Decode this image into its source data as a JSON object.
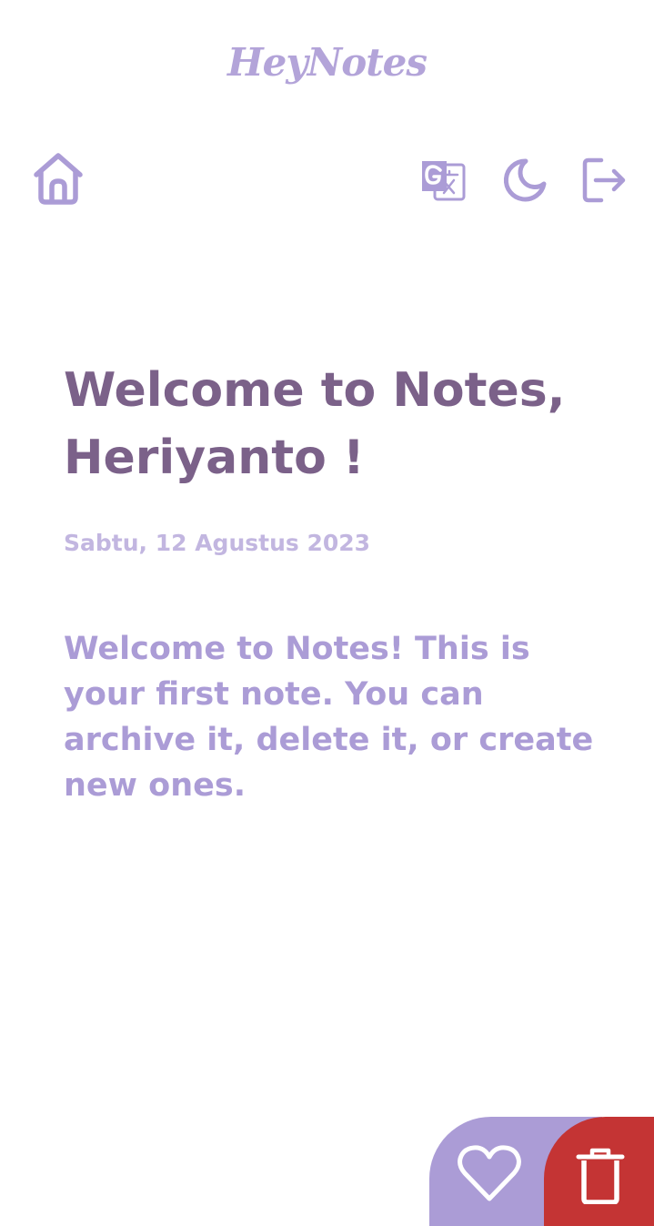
{
  "app": {
    "brand": "HeyNotes"
  },
  "header": {
    "icons": [
      "home-icon",
      "translate-icon",
      "moon-icon",
      "logout-icon"
    ]
  },
  "note": {
    "title": "Welcome to Notes, Heriyanto !",
    "date": "Sabtu, 12 Agustus 2023",
    "body": "Welcome to Notes! This is your first note. You can archive it, delete it, or create new ones."
  },
  "actions": {
    "archive_icon": "heart-icon",
    "delete_icon": "trash-icon"
  },
  "colors": {
    "accent": "#ab9cd6",
    "title": "#7b6189",
    "date": "#c2b6e0",
    "danger": "#c43434",
    "background": "#ffffff"
  }
}
